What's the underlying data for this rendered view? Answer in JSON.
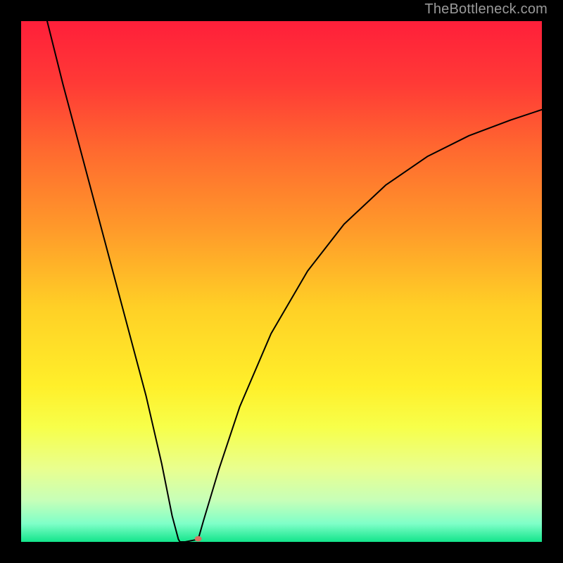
{
  "watermark": "TheBottleneck.com",
  "chart_data": {
    "type": "line",
    "title": "",
    "xlabel": "",
    "ylabel": "",
    "xlim": [
      0,
      100
    ],
    "ylim": [
      0,
      100
    ],
    "grid": false,
    "legend": false,
    "background_gradient": {
      "stops": [
        {
          "offset": 0.0,
          "color": "#ff1f3a"
        },
        {
          "offset": 0.12,
          "color": "#ff3a36"
        },
        {
          "offset": 0.25,
          "color": "#ff6a2f"
        },
        {
          "offset": 0.4,
          "color": "#ff9a2a"
        },
        {
          "offset": 0.55,
          "color": "#ffd026"
        },
        {
          "offset": 0.7,
          "color": "#ffef2a"
        },
        {
          "offset": 0.78,
          "color": "#f7ff4a"
        },
        {
          "offset": 0.86,
          "color": "#e9ff8f"
        },
        {
          "offset": 0.92,
          "color": "#c7ffb8"
        },
        {
          "offset": 0.965,
          "color": "#7fffc8"
        },
        {
          "offset": 1.0,
          "color": "#13e58b"
        }
      ]
    },
    "series": [
      {
        "name": "bottleneck-curve",
        "color": "#000000",
        "width": 2,
        "x": [
          5,
          8,
          12,
          16,
          20,
          24,
          27,
          29,
          30.2,
          30.5,
          31.5,
          34,
          35,
          38,
          42,
          48,
          55,
          62,
          70,
          78,
          86,
          94,
          100
        ],
        "y": [
          100,
          88,
          73,
          58,
          43,
          28,
          15,
          5,
          0.5,
          0,
          0,
          0.5,
          4,
          14,
          26,
          40,
          52,
          61,
          68.5,
          74,
          78,
          81,
          83
        ]
      }
    ],
    "marker": {
      "name": "optimal-point",
      "x": 34,
      "y": 0.6,
      "rx": 5,
      "ry": 3.8,
      "color": "#d87060"
    }
  }
}
